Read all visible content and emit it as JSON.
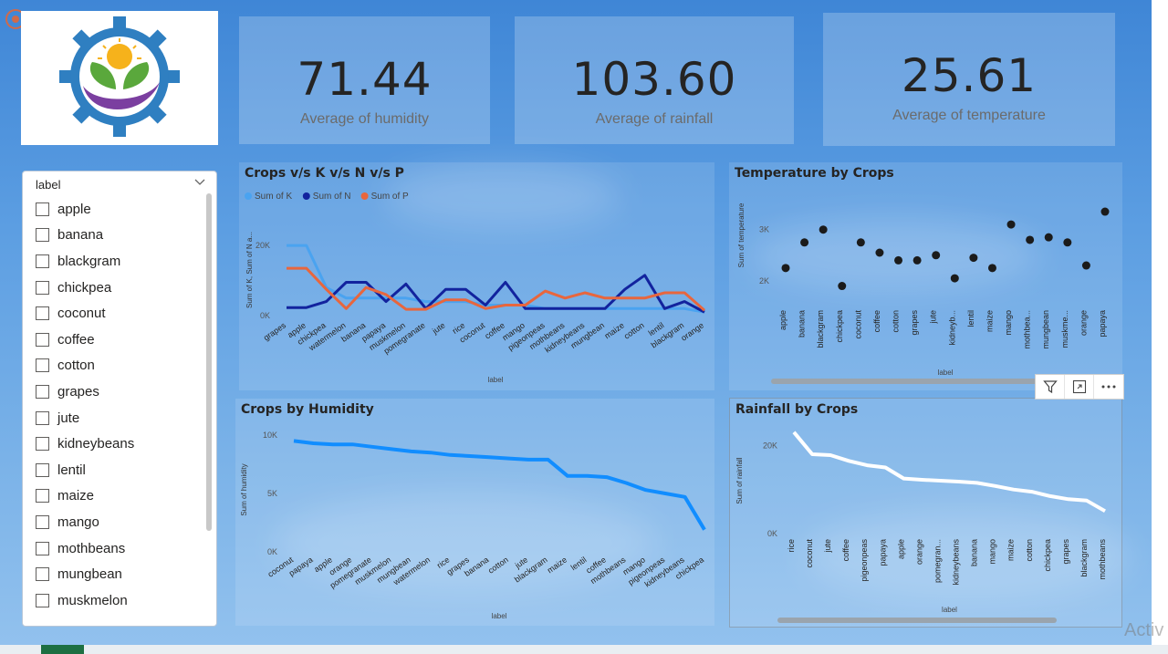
{
  "kpis": [
    {
      "value": "71.44",
      "label": "Average of humidity"
    },
    {
      "value": "103.60",
      "label": "Average of rainfall"
    },
    {
      "value": "25.61",
      "label": "Average of temperature"
    }
  ],
  "slicer": {
    "title": "label",
    "items": [
      "apple",
      "banana",
      "blackgram",
      "chickpea",
      "coconut",
      "coffee",
      "cotton",
      "grapes",
      "jute",
      "kidneybeans",
      "lentil",
      "maize",
      "mango",
      "mothbeans",
      "mungbean",
      "muskmelon"
    ]
  },
  "watermark": "Activ",
  "icons": {
    "logo": "agri-gear-logo",
    "filter": "filter-icon",
    "focus": "focus-mode-icon",
    "more": "more-options-icon",
    "dropdown": "chevron-down-icon"
  },
  "colors": {
    "k": "#4aa3f0",
    "n": "#12239e",
    "p": "#e8663d",
    "humidity": "#118dff",
    "rainfall": "#ffffff",
    "temperature": "#1b1b1b"
  },
  "chart_data": [
    {
      "id": "npk",
      "type": "line",
      "title": "Crops v/s K v/s N v/s P",
      "xlabel": "label",
      "ylabel": "Sum of K, Sum of N a...",
      "ylim": [
        0,
        26000
      ],
      "yticks": [
        {
          "v": 0,
          "t": "0K"
        },
        {
          "v": 20000,
          "t": "20K"
        }
      ],
      "legend": "top-left",
      "categories": [
        "grapes",
        "apple",
        "chickpea",
        "watermelon",
        "banana",
        "papaya",
        "muskmelon",
        "pomegranate",
        "jute",
        "rice",
        "coconut",
        "coffee",
        "mango",
        "pigeonpeas",
        "mothbeans",
        "kidneybeans",
        "mungbean",
        "maize",
        "cotton",
        "lentil",
        "blackgram",
        "orange"
      ],
      "series": [
        {
          "name": "Sum of K",
          "color": "#4aa3f0",
          "values": [
            20000,
            20000,
            8000,
            5000,
            5000,
            5000,
            5000,
            4000,
            4000,
            4000,
            3000,
            3000,
            3000,
            2000,
            2000,
            2000,
            2000,
            2000,
            2000,
            2000,
            2000,
            1000
          ]
        },
        {
          "name": "Sum of N",
          "color": "#12239e",
          "values": [
            2300,
            2300,
            4000,
            9500,
            9500,
            4000,
            9000,
            2000,
            7500,
            7500,
            3000,
            9500,
            2000,
            2000,
            2000,
            2000,
            2000,
            7500,
            11500,
            2000,
            4000,
            1000
          ]
        },
        {
          "name": "Sum of P",
          "color": "#e8663d",
          "values": [
            13500,
            13500,
            7500,
            2000,
            8000,
            6000,
            1800,
            1800,
            4500,
            4500,
            2000,
            3000,
            3000,
            7000,
            5000,
            6500,
            5000,
            5000,
            5000,
            6500,
            6500,
            1500
          ]
        }
      ]
    },
    {
      "id": "humidity",
      "type": "line",
      "title": "Crops by Humidity",
      "xlabel": "label",
      "ylabel": "Sum of humidity",
      "ylim": [
        0,
        10000
      ],
      "yticks": [
        {
          "v": 0,
          "t": "0K"
        },
        {
          "v": 5000,
          "t": "5K"
        },
        {
          "v": 10000,
          "t": "10K"
        }
      ],
      "categories": [
        "coconut",
        "papaya",
        "apple",
        "orange",
        "pomegranate",
        "muskmelon",
        "mungbean",
        "watermelon",
        "rice",
        "grapes",
        "banana",
        "cotton",
        "jute",
        "blackgram",
        "maize",
        "lentil",
        "coffee",
        "mothbeans",
        "mango",
        "pigeonpeas",
        "kidneybeans",
        "chickpea"
      ],
      "series": [
        {
          "name": "Sum of humidity",
          "color": "#118dff",
          "values": [
            9500,
            9300,
            9200,
            9200,
            9000,
            8800,
            8600,
            8500,
            8300,
            8200,
            8100,
            8000,
            7900,
            7900,
            6500,
            6500,
            6400,
            5900,
            5300,
            5000,
            4700,
            1900
          ]
        }
      ]
    },
    {
      "id": "temperature",
      "type": "scatter",
      "title": "Temperature by Crops",
      "xlabel": "label",
      "ylabel": "Sum of temperature",
      "ylim": [
        1500,
        3600
      ],
      "yticks": [
        {
          "v": 2000,
          "t": "2K"
        },
        {
          "v": 3000,
          "t": "3K"
        }
      ],
      "categories": [
        "apple",
        "banana",
        "blackgram",
        "chickpea",
        "coconut",
        "coffee",
        "cotton",
        "grapes",
        "jute",
        "kidneyb...",
        "lentil",
        "maize",
        "mango",
        "mothbea...",
        "mungbean",
        "muskme...",
        "orange",
        "papaya"
      ],
      "series": [
        {
          "name": "Sum of temperature",
          "color": "#1b1b1b",
          "values": [
            2250,
            2750,
            3000,
            1900,
            2750,
            2550,
            2400,
            2400,
            2500,
            2050,
            2450,
            2250,
            3100,
            2800,
            2850,
            2750,
            2300,
            3350
          ]
        }
      ]
    },
    {
      "id": "rainfall",
      "type": "line",
      "title": "Rainfall by Crops",
      "xlabel": "label",
      "ylabel": "Sum of rainfall",
      "ylim": [
        0,
        24000
      ],
      "yticks": [
        {
          "v": 0,
          "t": "0K"
        },
        {
          "v": 20000,
          "t": "20K"
        }
      ],
      "categories": [
        "rice",
        "coconut",
        "jute",
        "coffee",
        "pigeonpeas",
        "papaya",
        "apple",
        "orange",
        "pomegran...",
        "kidneybeans",
        "banana",
        "mango",
        "maize",
        "cotton",
        "chickpea",
        "grapes",
        "blackgram",
        "mothbeans"
      ],
      "series": [
        {
          "name": "Sum of rainfall",
          "color": "#ffffff",
          "values": [
            23000,
            18000,
            17800,
            16500,
            15500,
            15000,
            12500,
            12200,
            12000,
            11800,
            11500,
            10800,
            10000,
            9500,
            8500,
            7800,
            7500,
            5100
          ]
        }
      ]
    }
  ]
}
